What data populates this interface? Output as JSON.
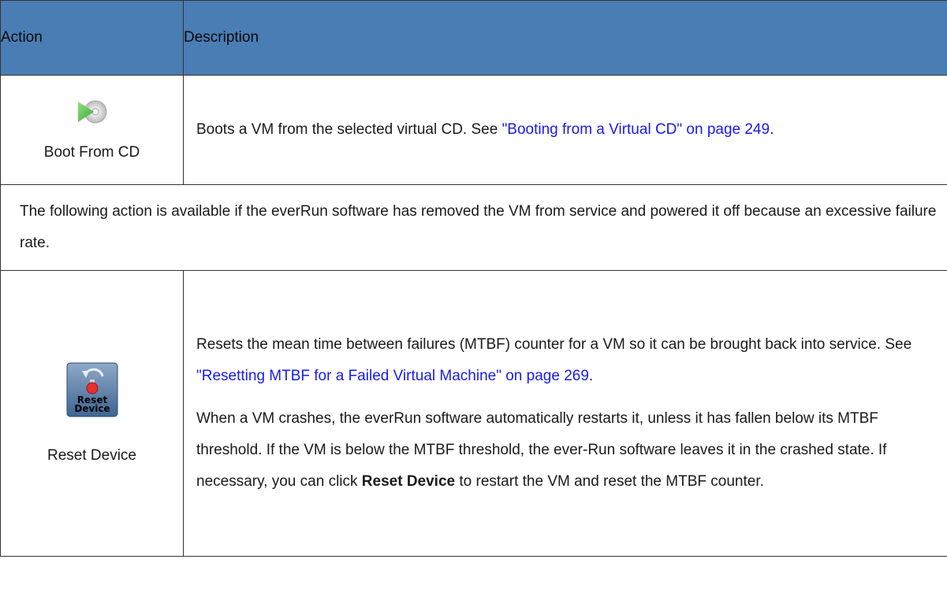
{
  "header": {
    "action": "Action",
    "description": "Description"
  },
  "rows": [
    {
      "action_label": "Boot From CD",
      "icon": "play-cd-icon",
      "desc_text": "Boots a VM from the selected virtual CD. See ",
      "desc_link": "\"Booting from a Virtual CD\" on page 249",
      "desc_after": "."
    },
    {
      "note": "The following action is available if the everRun software has removed the VM from service and powered it off because an excessive failure rate."
    },
    {
      "action_label": "Reset Device",
      "icon": "reset-device-icon",
      "icon_text_line1": "Reset",
      "icon_text_line2": "Device",
      "desc_text": "Resets the mean time between failures (MTBF) counter for a VM so it can be brought back into service. See ",
      "desc_link": "\"Resetting MTBF for a Failed Virtual Machine\" on page 269",
      "desc_after": ".",
      "desc2_before": "When a VM crashes, the everRun software automatically restarts it, unless it has fallen below its MTBF threshold. If the VM is below the MTBF threshold, the ever-Run software leaves it in the crashed state. If necessary, you can click ",
      "desc2_bold": "Reset Device",
      "desc2_after": " to restart the VM and reset the MTBF counter."
    }
  ],
  "colors": {
    "header_bg": "#4a7db3",
    "link": "#1a1aee",
    "border": "#333333"
  }
}
